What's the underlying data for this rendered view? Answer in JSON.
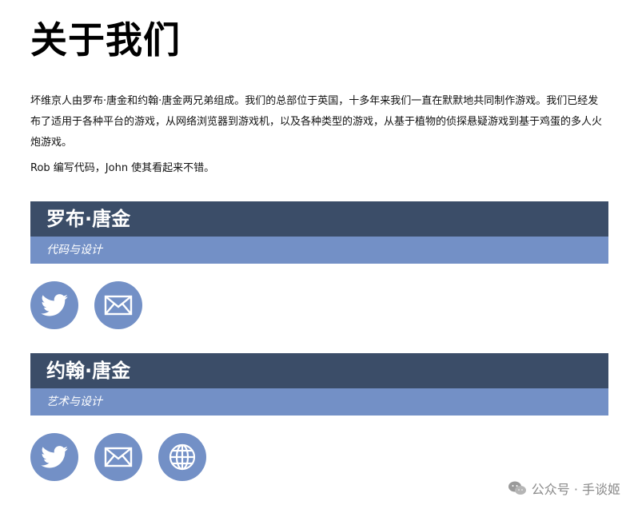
{
  "page": {
    "title": "关于我们",
    "intro": "坏维京人由罗布·唐金和约翰·唐金两兄弟组成。我们的总部位于英国，十多年来我们一直在默默地共同制作游戏。我们已经发布了适用于各种平台的游戏，从网络浏览器到游戏机，以及各种类型的游戏，从基于植物的侦探悬疑游戏到基于鸡蛋的多人火炮游戏。",
    "intro2": "Rob 编写代码，John 使其看起来不错。"
  },
  "members": [
    {
      "name": "罗布·唐金",
      "role": "代码与设计",
      "icons": [
        "twitter-icon",
        "mail-icon"
      ]
    },
    {
      "name": "约翰·唐金",
      "role": "艺术与设计",
      "icons": [
        "twitter-icon",
        "mail-icon",
        "globe-icon"
      ]
    }
  ],
  "watermark": {
    "text": "公众号 · 手谈姬",
    "icon": "wechat-icon"
  },
  "colors": {
    "header": "#3b4d68",
    "subheader": "#7390c6",
    "icon_bg": "#7390c6"
  }
}
